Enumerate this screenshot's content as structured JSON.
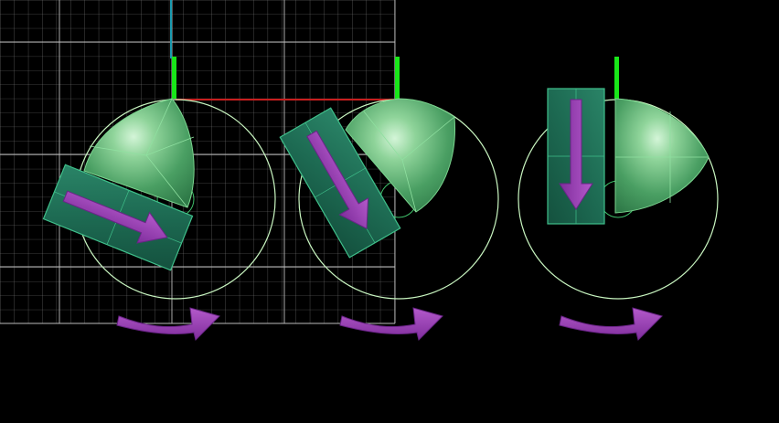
{
  "viewport": {
    "background": "#000000",
    "grid_color": "#8a8a8a",
    "grid_major_color": "#c8c8c8"
  },
  "axes": {
    "y_axis_color": "#1a9bb0",
    "x_axis_color": "#c81e1e",
    "gizmo_color": "#19e619"
  },
  "objects": [
    {
      "name": "figure-1",
      "pose": "tilted-left",
      "rotation_deg": 22
    },
    {
      "name": "figure-2",
      "pose": "tilted-more",
      "rotation_deg": 60
    },
    {
      "name": "figure-3",
      "pose": "upright-pointing-down",
      "rotation_deg": 90
    }
  ],
  "colors": {
    "block_fill": "#1f6e55",
    "block_edge": "#3fbf8a",
    "dome_fill": "#4fae6f",
    "dome_highlight": "#bfeec8",
    "wire_circle": "#c8f5c0",
    "arrow_fill": "#9b3fb5",
    "arrow_edge": "#6a2487"
  },
  "icons": {
    "rotation_hint": "curved-arrow-right-icon",
    "direction": "straight-arrow-icon"
  }
}
